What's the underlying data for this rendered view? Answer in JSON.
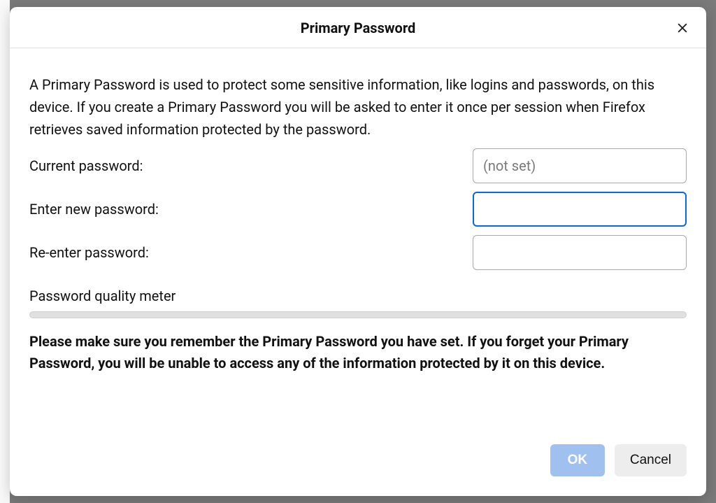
{
  "dialog": {
    "title": "Primary Password",
    "intro": "A Primary Password is used to protect some sensitive information, like logins and passwords, on this device. If you create a Primary Password you will be asked to enter it once per session when Firefox retrieves saved information protected by the password.",
    "currentLabel": "Current password:",
    "currentPlaceholder": "(not set)",
    "newLabel": "Enter new password:",
    "reenterLabel": "Re-enter password:",
    "meterLabel": "Password quality meter",
    "warning": "Please make sure you remember the Primary Password you have set. If you forget your Primary Password, you will be unable to access any of the information protected by it on this device.",
    "okLabel": "OK",
    "cancelLabel": "Cancel"
  }
}
